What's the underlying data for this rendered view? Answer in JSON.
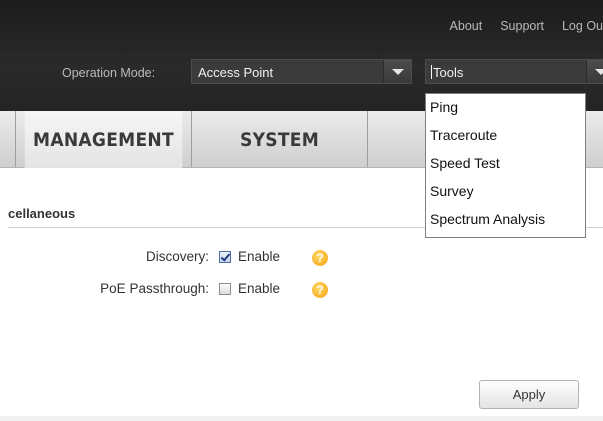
{
  "header": {
    "links": [
      "About",
      "Support",
      "Log Ou"
    ],
    "operation_mode_label": "Operation Mode:",
    "operation_mode_value": "Access Point",
    "tools_value": "Tools"
  },
  "tabs": [
    {
      "label": "MANAGEMENT",
      "active": true
    },
    {
      "label": "SYSTEM",
      "active": false
    },
    {
      "label": "",
      "active": false
    }
  ],
  "tools_menu": {
    "options": [
      "Ping",
      "Traceroute",
      "Speed Test",
      "Survey",
      "Spectrum Analysis"
    ]
  },
  "section": {
    "title": "cellaneous",
    "rows": [
      {
        "label": "Discovery:",
        "checked": true,
        "option_label": "Enable",
        "help": "?"
      },
      {
        "label": "PoE Passthrough:",
        "checked": false,
        "option_label": "Enable",
        "help": "?"
      }
    ]
  },
  "actions": {
    "apply_label": "Apply"
  },
  "colors": {
    "header_bg": "#1c1c1c",
    "select_bg": "#3b3b3b",
    "tab_bg": "#cfcfcf",
    "help_icon": "#f2a413",
    "checkbox_checked": "#1f3f7a"
  },
  "icons": [
    "dropdown-arrow-icon",
    "help-icon",
    "checkbox-checked-icon"
  ]
}
